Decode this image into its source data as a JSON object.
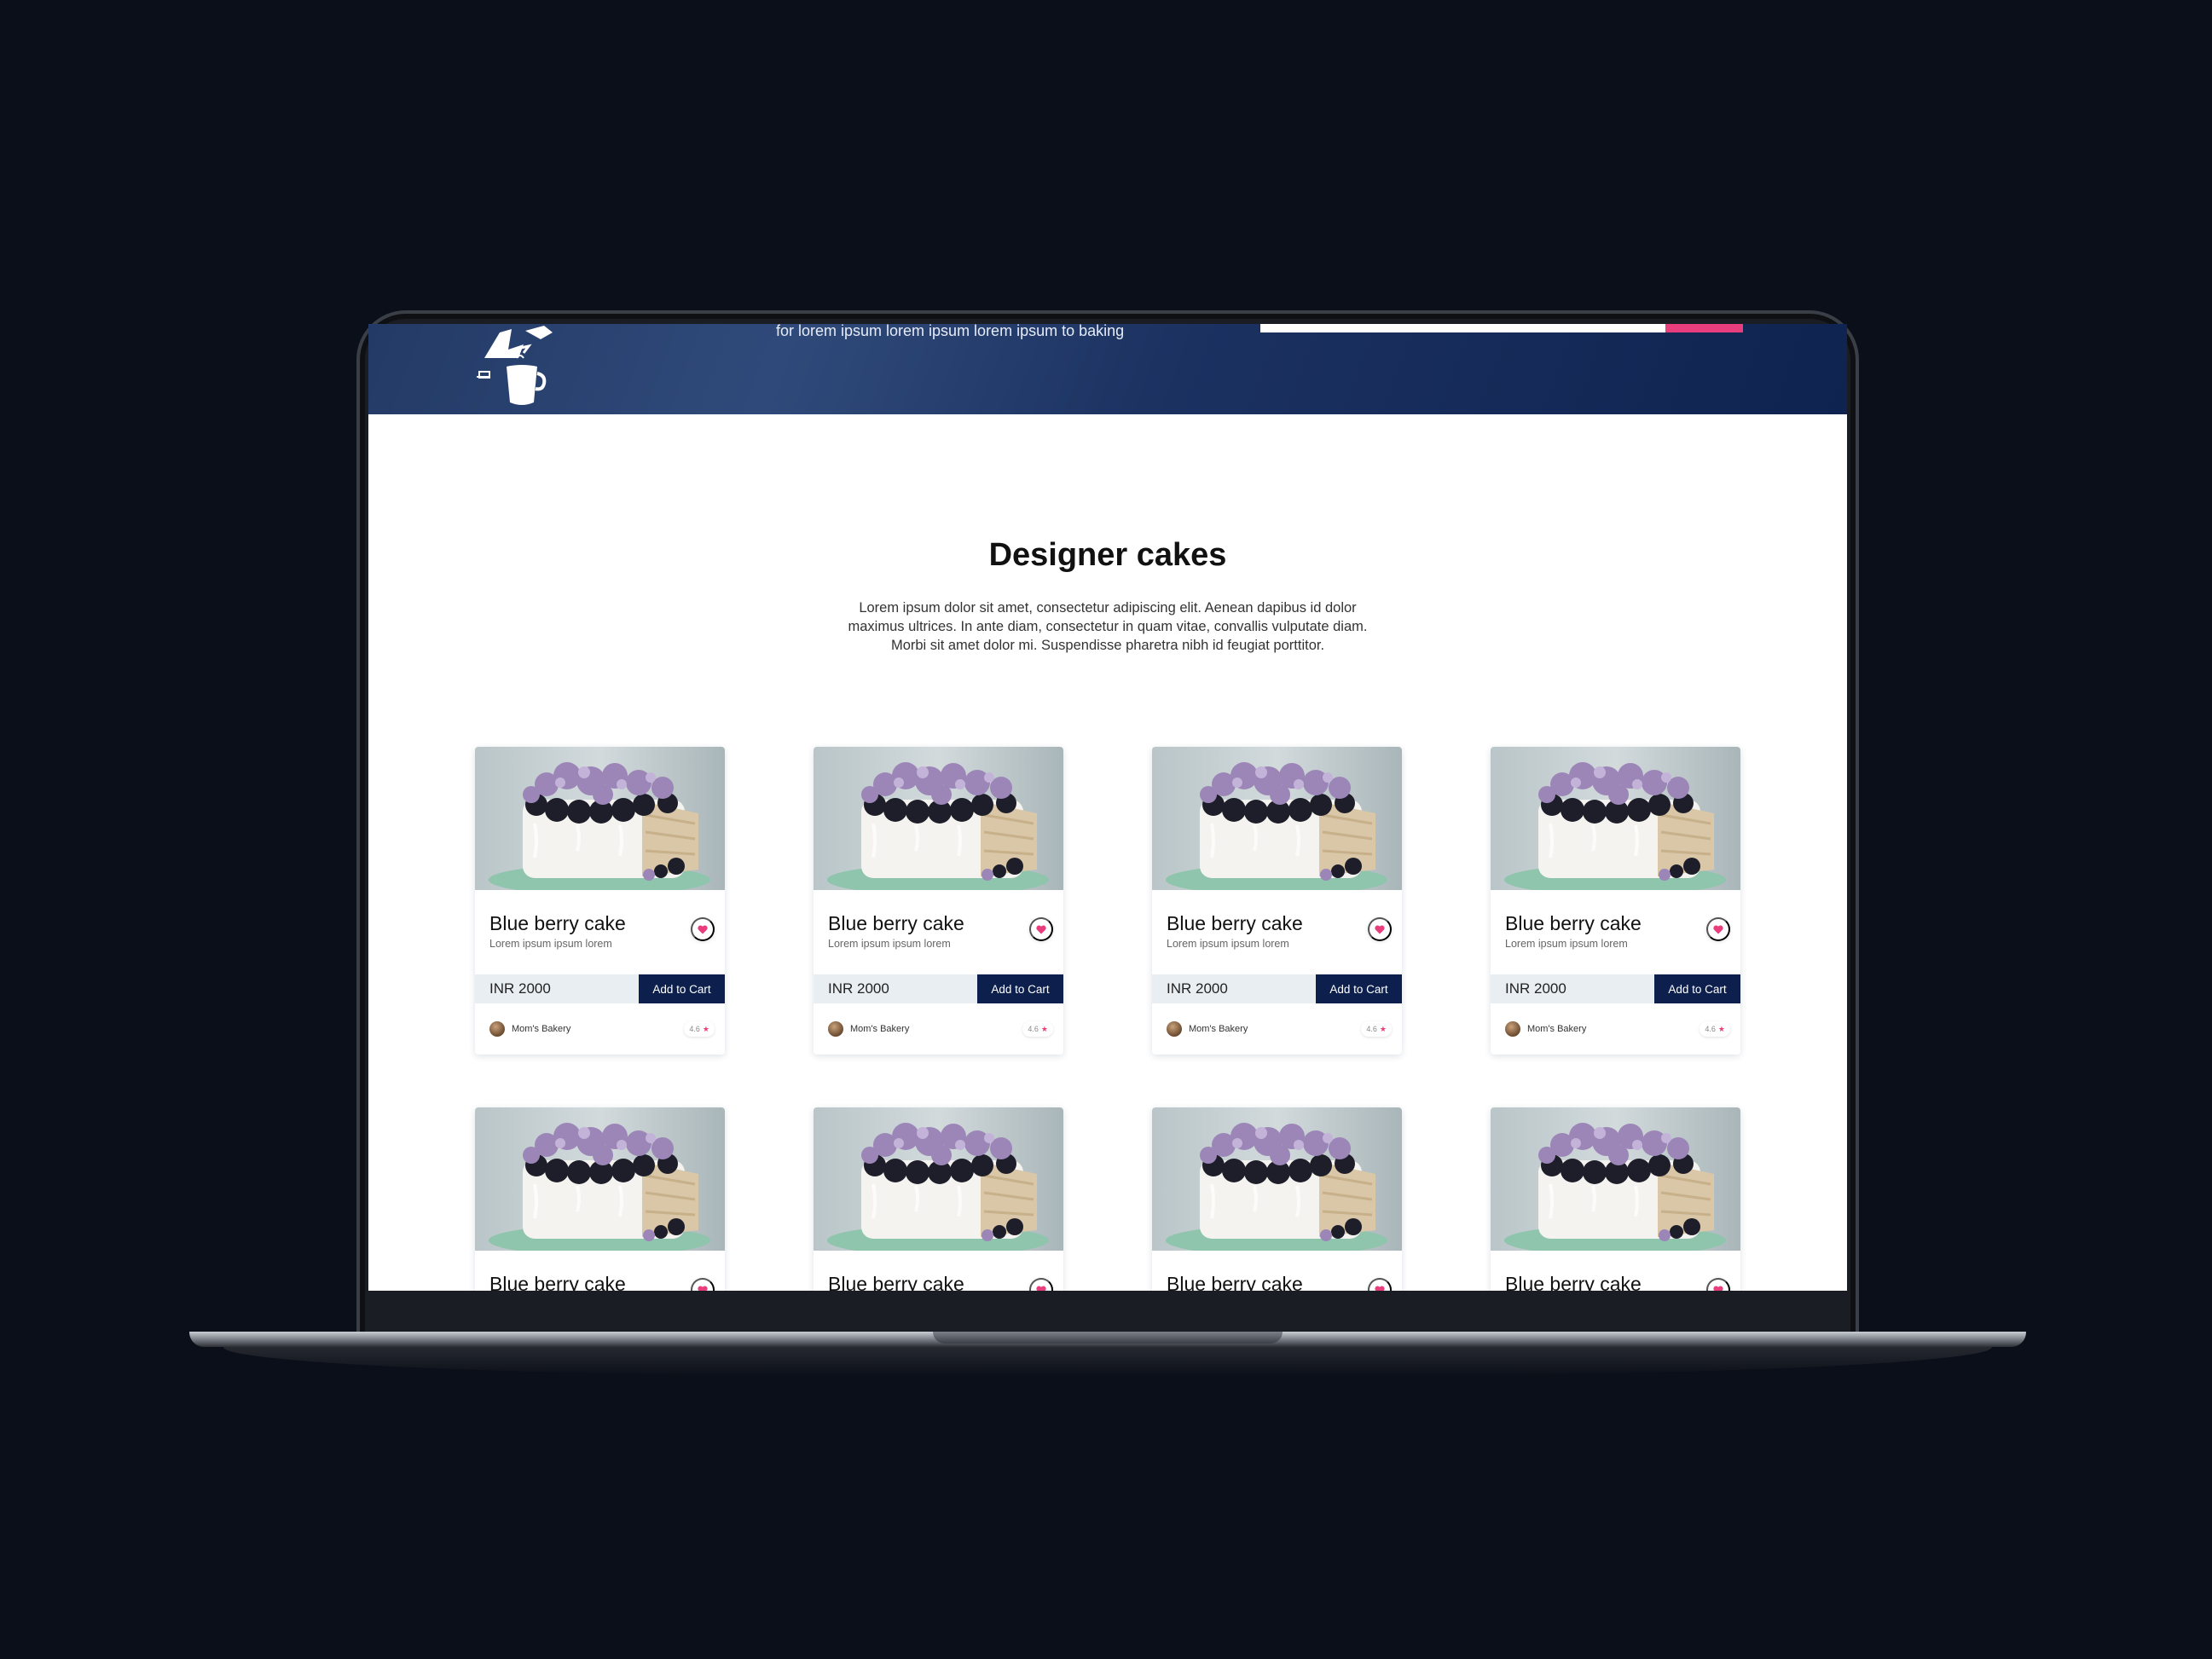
{
  "hero": {
    "tagline": "for lorem ipsum lorem ipsum lorem ipsum to baking",
    "progress_fraction": 0.16
  },
  "section": {
    "title": "Designer cakes",
    "description": "Lorem ipsum dolor sit amet, consectetur adipiscing elit. Aenean dapibus id dolor maximus ultrices. In ante diam, consectetur in quam vitae, convallis vulputate diam. Morbi sit amet dolor mi. Suspendisse pharetra nibh id feugiat porttitor."
  },
  "colors": {
    "accent": "#e83e7d",
    "button_navy": "#0d1f4d",
    "hero_blue": "#1b3160"
  },
  "products": [
    {
      "title": "Blue berry cake",
      "subtitle": "Lorem ipsum ipsum lorem",
      "price": "INR 2000",
      "cart_label": "Add to Cart",
      "seller": "Mom's Bakery",
      "rating": "4.6",
      "icon": "heart-icon"
    },
    {
      "title": "Blue berry cake",
      "subtitle": "Lorem ipsum ipsum lorem",
      "price": "INR 2000",
      "cart_label": "Add to Cart",
      "seller": "Mom's Bakery",
      "rating": "4.6",
      "icon": "heart-icon"
    },
    {
      "title": "Blue berry cake",
      "subtitle": "Lorem ipsum ipsum lorem",
      "price": "INR 2000",
      "cart_label": "Add to Cart",
      "seller": "Mom's Bakery",
      "rating": "4.6",
      "icon": "heart-icon"
    },
    {
      "title": "Blue berry cake",
      "subtitle": "Lorem ipsum ipsum lorem",
      "price": "INR 2000",
      "cart_label": "Add to Cart",
      "seller": "Mom's Bakery",
      "rating": "4.6",
      "icon": "heart-icon"
    },
    {
      "title": "Blue berry cake",
      "subtitle": "",
      "price": "",
      "cart_label": "",
      "seller": "",
      "rating": "",
      "icon": "heart-icon"
    },
    {
      "title": "Blue berry cake",
      "subtitle": "",
      "price": "",
      "cart_label": "",
      "seller": "",
      "rating": "",
      "icon": "heart-icon"
    },
    {
      "title": "Blue berry cake",
      "subtitle": "",
      "price": "",
      "cart_label": "",
      "seller": "",
      "rating": "",
      "icon": "heart-icon"
    },
    {
      "title": "Blue berry cake",
      "subtitle": "",
      "price": "",
      "cart_label": "",
      "seller": "",
      "rating": "",
      "icon": "heart-icon"
    }
  ]
}
